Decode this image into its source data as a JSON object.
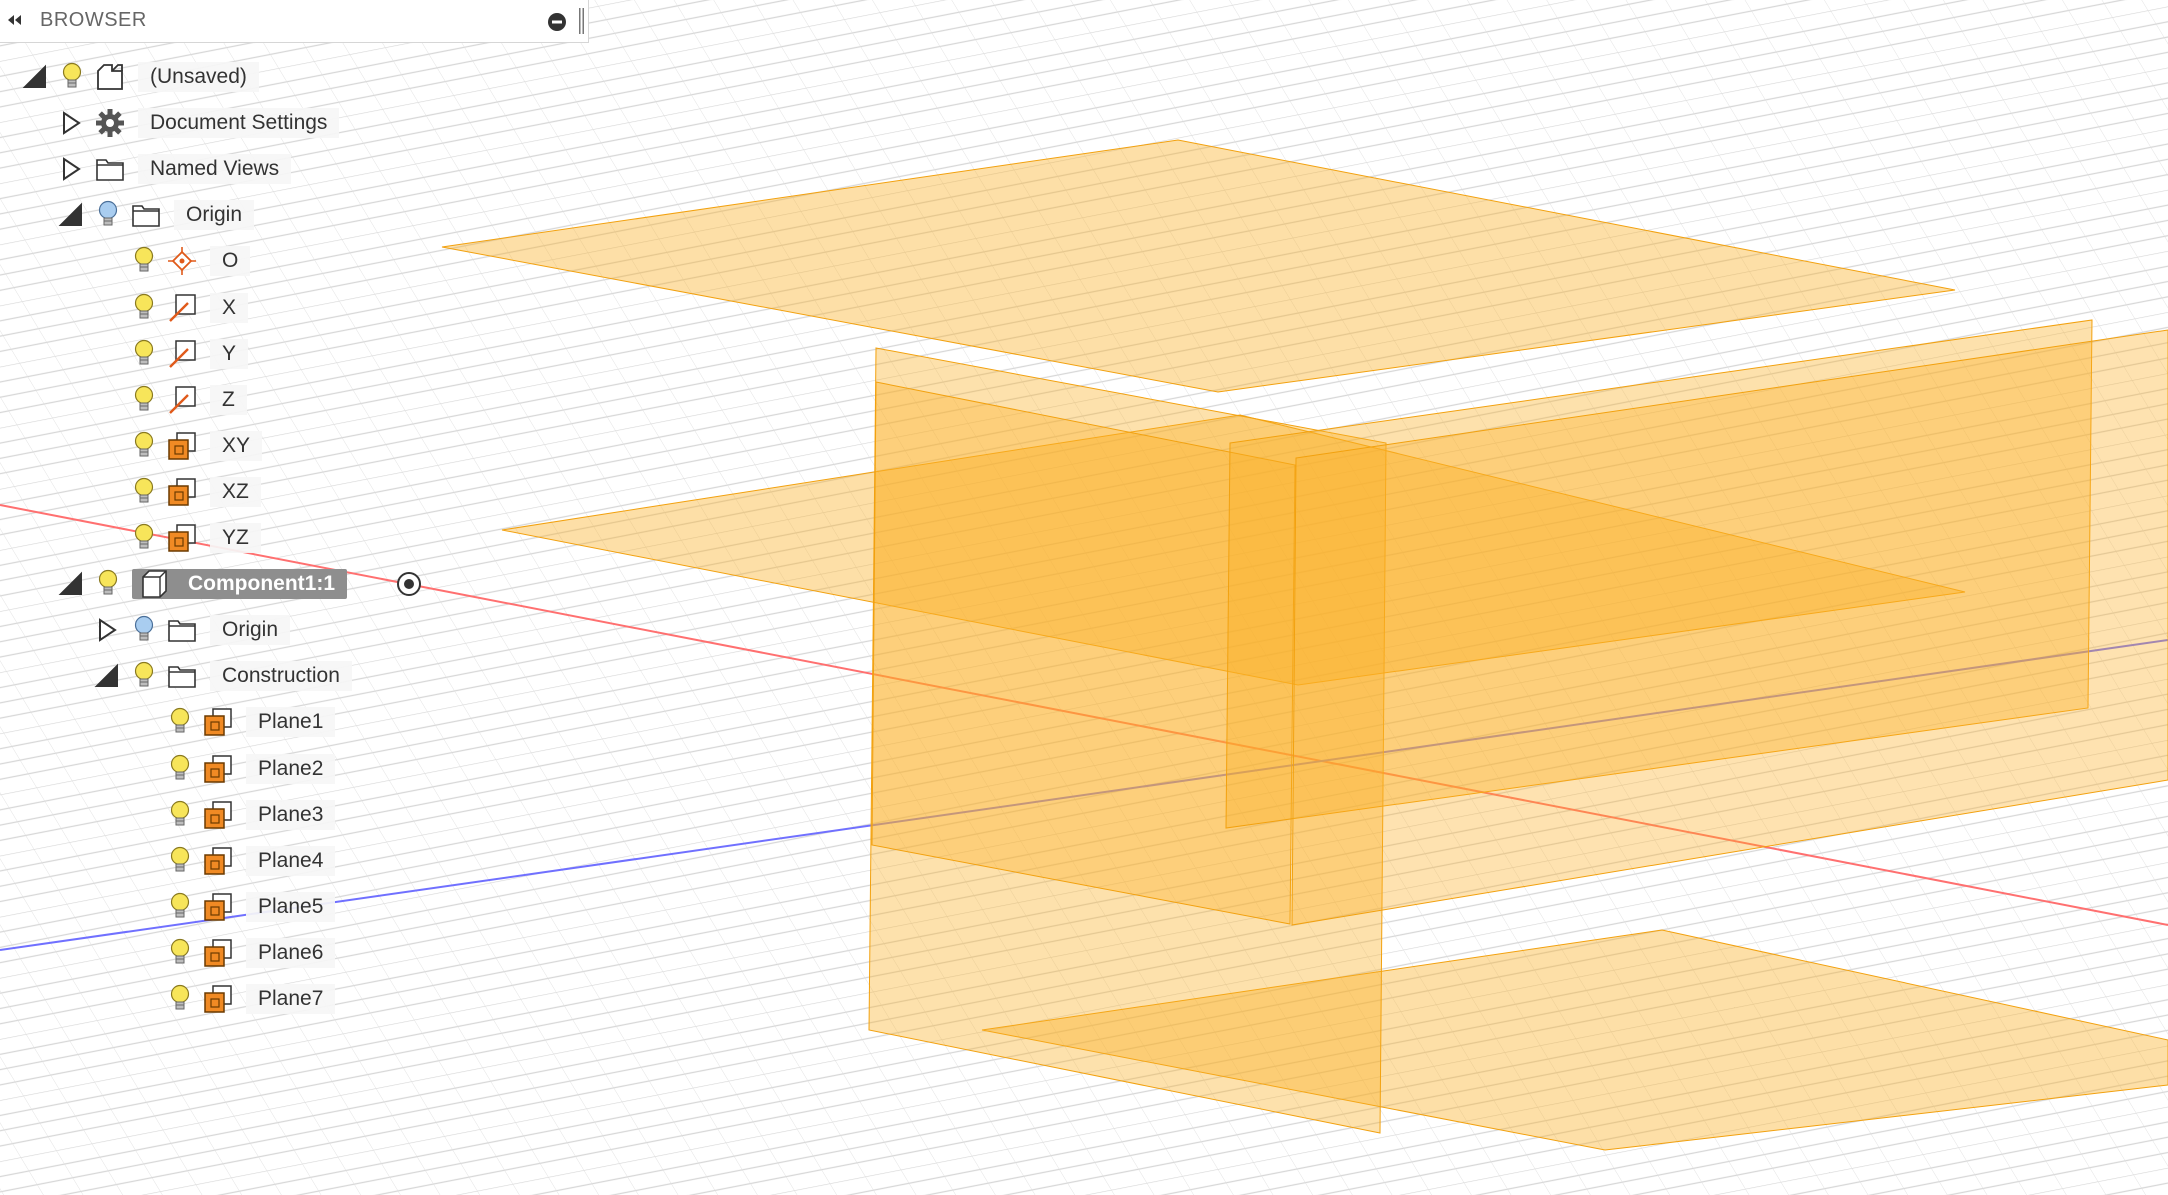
{
  "panel": {
    "title": "BROWSER"
  },
  "tree": {
    "root": {
      "label": "(Unsaved)",
      "expanded": true,
      "icon": "document-icon"
    },
    "document_settings": {
      "label": "Document Settings",
      "expanded": false,
      "icon": "gear-icon"
    },
    "named_views": {
      "label": "Named Views",
      "expanded": false,
      "icon": "folder-icon"
    },
    "origin": {
      "label": "Origin",
      "expanded": true,
      "icon": "folder-icon",
      "items": [
        {
          "label": "O",
          "icon": "origin-point-icon"
        },
        {
          "label": "X",
          "icon": "axis-icon"
        },
        {
          "label": "Y",
          "icon": "axis-icon"
        },
        {
          "label": "Z",
          "icon": "axis-icon"
        },
        {
          "label": "XY",
          "icon": "plane-icon"
        },
        {
          "label": "XZ",
          "icon": "plane-icon"
        },
        {
          "label": "YZ",
          "icon": "plane-icon"
        }
      ]
    },
    "component": {
      "label": "Component1:1",
      "expanded": true,
      "active": true,
      "icon": "component-icon",
      "origin": {
        "label": "Origin",
        "expanded": false,
        "icon": "folder-icon"
      },
      "construction": {
        "label": "Construction",
        "expanded": true,
        "icon": "folder-icon",
        "items": [
          {
            "label": "Plane1",
            "icon": "plane-icon"
          },
          {
            "label": "Plane2",
            "icon": "plane-icon"
          },
          {
            "label": "Plane3",
            "icon": "plane-icon"
          },
          {
            "label": "Plane4",
            "icon": "plane-icon"
          },
          {
            "label": "Plane5",
            "icon": "plane-icon"
          },
          {
            "label": "Plane6",
            "icon": "plane-icon"
          },
          {
            "label": "Plane7",
            "icon": "plane-icon"
          }
        ]
      }
    }
  },
  "colors": {
    "plane_fill": "#fbb024",
    "bulb_on": "#f7e55a",
    "bulb_off": "#a9cdf0",
    "plane_icon": "#f08a24",
    "origin_point": "#e05a1a",
    "axis_red": "#ff6a6a",
    "axis_blue": "#6a6aff",
    "selection": "#8e8e8e"
  }
}
